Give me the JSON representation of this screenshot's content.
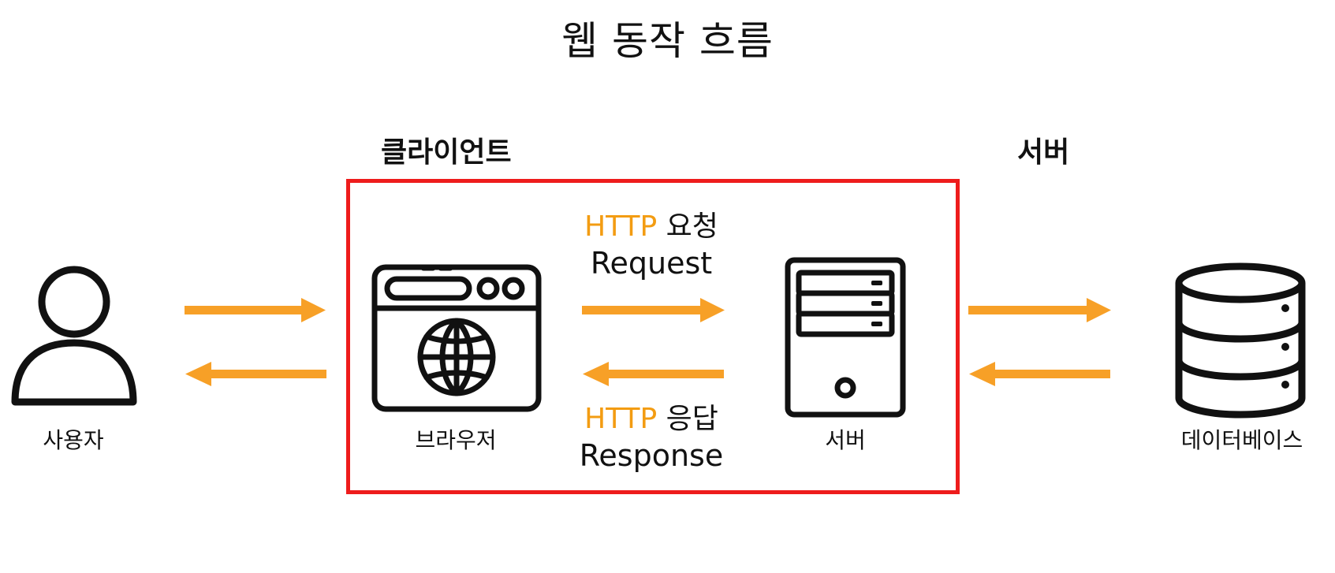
{
  "title": "웹 동작 흐름",
  "sections": {
    "client": "클라이언트",
    "server": "서버"
  },
  "nodes": {
    "user": {
      "label": "사용자",
      "icon": "user-icon"
    },
    "browser": {
      "label": "브라우저",
      "icon": "browser-globe-icon"
    },
    "server": {
      "label": "서버",
      "icon": "server-tower-icon"
    },
    "database": {
      "label": "데이터베이스",
      "icon": "database-icon"
    }
  },
  "flows": {
    "request": {
      "protocol": "HTTP",
      "kind": "요청",
      "english": "Request"
    },
    "response": {
      "protocol": "HTTP",
      "kind": "응답",
      "english": "Response"
    }
  },
  "colors": {
    "arrow": "#f7a027",
    "protocol_text": "#f39c12",
    "client_frame": "#ee1c1c",
    "icon": "#111111"
  }
}
